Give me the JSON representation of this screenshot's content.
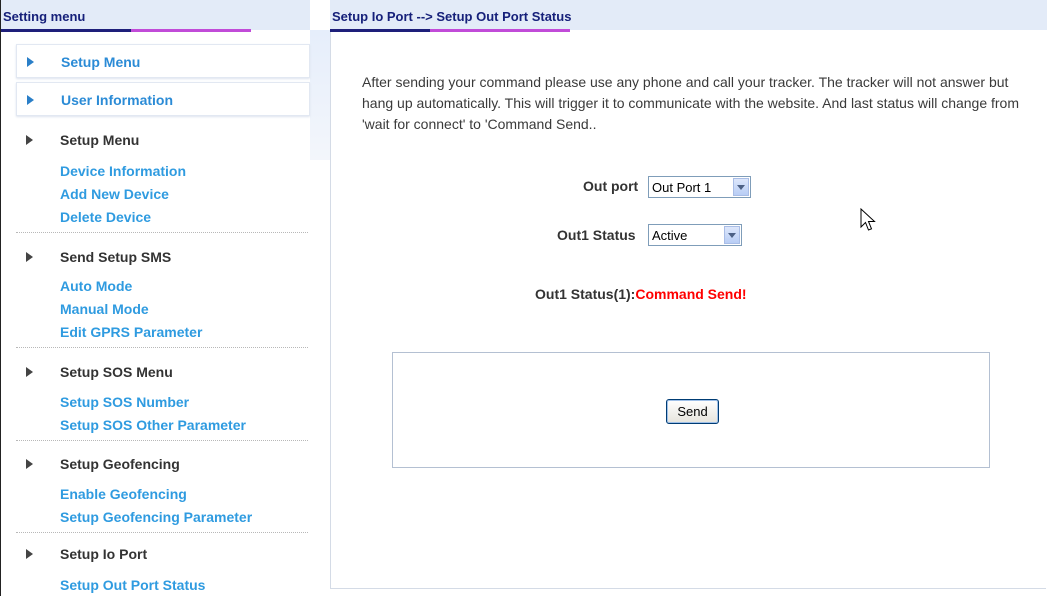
{
  "sidebar": {
    "title": "Setting menu",
    "top_items": [
      {
        "label": "Setup Menu"
      },
      {
        "label": "User Information"
      }
    ],
    "sections": [
      {
        "label": "Setup Menu",
        "links": [
          "Device Information",
          "Add New Device",
          "Delete Device"
        ]
      },
      {
        "label": "Send Setup SMS",
        "links": [
          "Auto Mode",
          "Manual Mode",
          "Edit GPRS Parameter"
        ]
      },
      {
        "label": "Setup SOS Menu",
        "links": [
          "Setup SOS Number",
          "Setup SOS Other Parameter"
        ]
      },
      {
        "label": "Setup Geofencing",
        "links": [
          "Enable Geofencing",
          "Setup Geofencing Parameter"
        ]
      },
      {
        "label": "Setup Io Port",
        "links": [
          "Setup Out Port Status"
        ]
      }
    ]
  },
  "main": {
    "title": "Setup Io Port --> Setup Out Port Status",
    "info": "After sending your command please use any phone and call your tracker. The tracker will not answer but hang up automatically. This will trigger it to communicate with the website. And last status will change from 'wait for connect' to 'Command Send..",
    "out_port": {
      "label": "Out port",
      "value": "Out Port 1"
    },
    "out_status": {
      "label": "Out1 Status",
      "value": "Active"
    },
    "status_line": {
      "label": "Out1 Status(1):",
      "value": "Command Send!"
    },
    "send_label": "Send"
  },
  "colors": {
    "link": "#2f9be0",
    "header_text": "#16207a",
    "status_red": "#ff0000",
    "header_bg": "#e3ebf8"
  },
  "icons": [
    "play-arrow-icon",
    "dropdown-arrow-icon",
    "mouse-pointer-icon"
  ]
}
